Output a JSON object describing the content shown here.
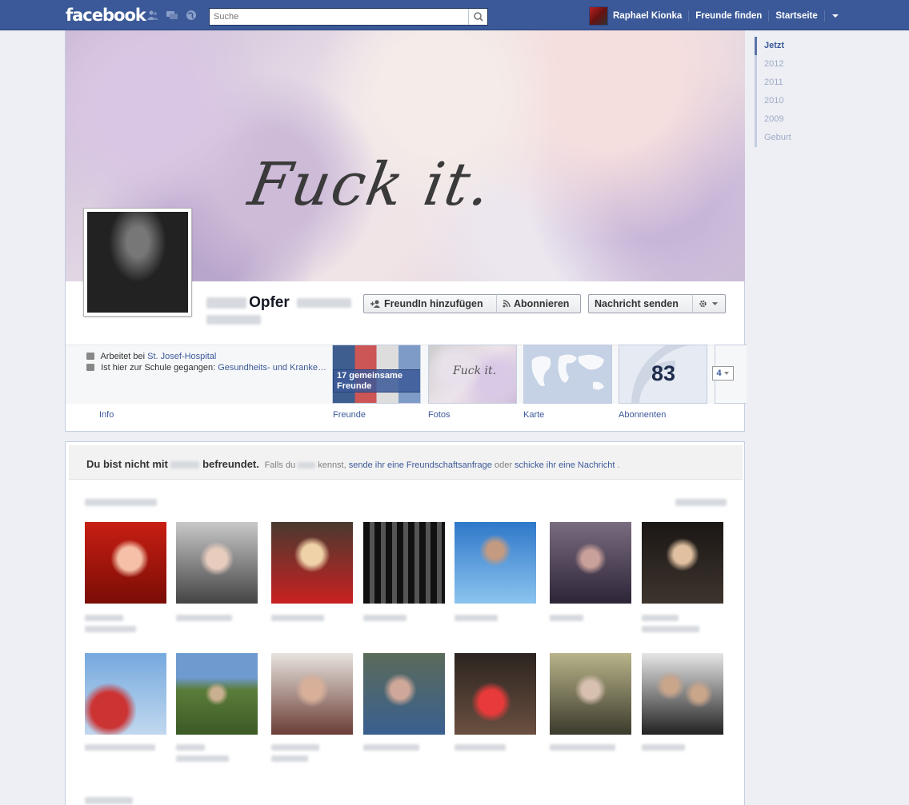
{
  "topbar": {
    "logo": "facebook",
    "search_placeholder": "Suche",
    "user_name": "Raphael Kionka",
    "find_friends": "Freunde finden",
    "home": "Startseite"
  },
  "timeline_nav": [
    "Jetzt",
    "2012",
    "2011",
    "2010",
    "2009",
    "Geburt"
  ],
  "cover_text": "Fuck it.",
  "profile": {
    "name": "Opfer",
    "add_friend_button": "FreundIn hinzufügen",
    "subscribe_button": "Abonnieren",
    "message_button": "Nachricht senden",
    "work_prefix": "Arbeitet bei ",
    "work_place": "St. Josef-Hospital",
    "school_prefix": "Ist hier zur Schule gegangen: ",
    "school_place": "Gesundheits- und Kranke…"
  },
  "tiles": {
    "mutual_friends": "17 gemeinsame Freunde",
    "photos_text": "Fuck it.",
    "subscriber_count": "83",
    "more_count": "4",
    "labels": {
      "info": "Info",
      "friends": "Freunde",
      "photos": "Fotos",
      "map": "Karte",
      "subscribers": "Abonnenten"
    }
  },
  "notice": {
    "title_prefix": "Du bist nicht mit ",
    "title_suffix": " befreundet.",
    "sub_prefix": "Falls du ",
    "sub_mid": " kennst, ",
    "link_request": "sende ihr eine Freundschaftsanfrage",
    "sub_or": " oder ",
    "link_message": "schicke ihr eine Nachricht",
    "sub_end": "."
  },
  "colors": {
    "brand_blue": "#3b5998",
    "page_bg": "#edeff4",
    "link": "#3b5998"
  },
  "icons": [
    "friend-requests-icon",
    "messages-icon",
    "notifications-icon",
    "search-icon",
    "dropdown-arrow-icon",
    "add-friend-icon",
    "rss-icon",
    "gear-icon",
    "briefcase-icon",
    "graduation-cap-icon"
  ]
}
